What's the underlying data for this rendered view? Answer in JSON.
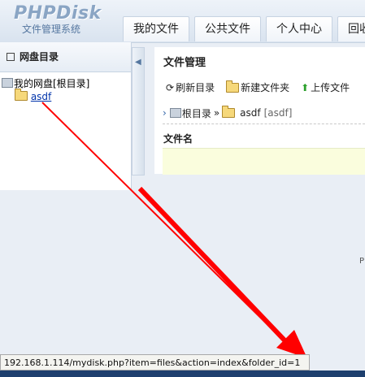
{
  "header": {
    "logo_text": "PHPDisk",
    "logo_sub": "文件管理系统",
    "tabs": [
      {
        "label": "我的文件"
      },
      {
        "label": "公共文件"
      },
      {
        "label": "个人中心"
      },
      {
        "label": "回收"
      }
    ]
  },
  "sidebar": {
    "title": "网盘目录",
    "tree": [
      {
        "label": "我的网盘[根目录]",
        "icon": "disk-icon"
      },
      {
        "label": "asdf",
        "icon": "folder-icon"
      }
    ]
  },
  "main": {
    "title": "文件管理",
    "toolbar": {
      "refresh_label": "刷新目录",
      "newfolder_label": "新建文件夹",
      "upload_label": "上传文件"
    },
    "breadcrumb": {
      "root_label": "根目录",
      "separator": "»",
      "current_folder": "asdf",
      "current_folder_bracket": "[asdf]"
    },
    "column_filename": "文件名"
  },
  "footer_fragment": "P",
  "status_url": "192.168.1.114/mydisk.php?item=files&action=index&folder_id=1",
  "colors": {
    "annotation_arrow": "#ff0000",
    "link_blue": "#0033aa",
    "row_highlight": "#fafddd"
  }
}
